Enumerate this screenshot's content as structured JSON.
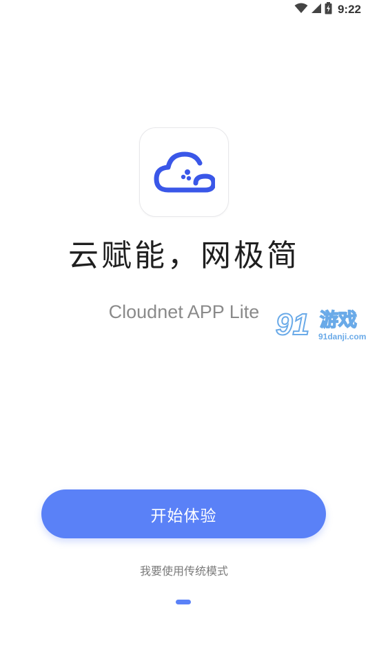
{
  "status_bar": {
    "time": "9:22",
    "icons": [
      "wifi-icon",
      "signal-icon",
      "battery-icon"
    ]
  },
  "app": {
    "icon": "cloud-logo-icon",
    "headline": "云赋能，网极简",
    "subtitle": "Cloudnet APP Lite"
  },
  "watermark": {
    "number": "91",
    "text": "游戏",
    "url": "91danji.com"
  },
  "actions": {
    "start_label": "开始体验",
    "traditional_mode_label": "我要使用传统模式"
  },
  "colors": {
    "accent": "#5a81f7",
    "logo": "#3a57e8"
  }
}
